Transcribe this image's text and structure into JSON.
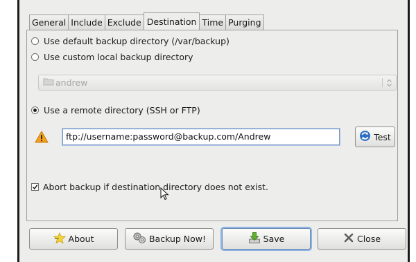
{
  "tabs": [
    {
      "label": "General",
      "active": false
    },
    {
      "label": "Include",
      "active": false
    },
    {
      "label": "Exclude",
      "active": false
    },
    {
      "label": "Destination",
      "active": true
    },
    {
      "label": "Time",
      "active": false
    },
    {
      "label": "Purging",
      "active": false
    }
  ],
  "destination": {
    "default_dir_label": "Use default backup directory (/var/backup)",
    "default_dir_selected": false,
    "custom_local_label": "Use custom local backup directory",
    "custom_local_selected": false,
    "local_folder_value": "andrew",
    "remote_label": "Use a remote directory (SSH or FTP)",
    "remote_selected": true,
    "remote_url": "ftp://username:password@backup.com/Andrew",
    "test_button_label": "Test",
    "abort_label": "Abort backup if destination directory does not exist.",
    "abort_checked": true
  },
  "buttons": {
    "about_label": "About",
    "backup_now_label": "Backup Now!",
    "save_label": "Save",
    "close_label": "Close"
  },
  "icons": {
    "warning": "warning-icon",
    "test": "refresh-icon",
    "about": "star-icon",
    "backup_now": "gears-icon",
    "save": "save-download-icon",
    "close": "close-x-icon",
    "folder": "folder-icon",
    "spin": "combo-spin-icon"
  },
  "colors": {
    "window_bg": "#ededec",
    "entry_focus": "#8db4e3",
    "warning": "#f2a01d"
  }
}
